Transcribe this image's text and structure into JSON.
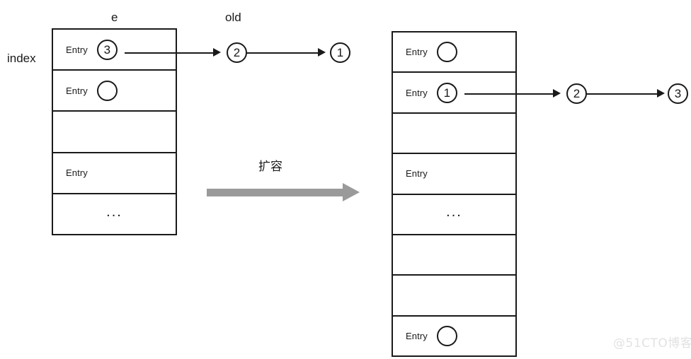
{
  "diagram": {
    "title_labels": {
      "index": "index",
      "e": "e",
      "old": "old"
    },
    "transform": {
      "label": "扩容",
      "arrow_color": "#9a9a9a"
    },
    "watermark": "@51CTO博客",
    "stroke_color": "#1a1a1a",
    "background_color": "#ffffff"
  },
  "left_table": {
    "name": "old-bucket-array",
    "rows": [
      {
        "label": "Entry",
        "node": "3",
        "dots": ""
      },
      {
        "label": "Entry",
        "node": "",
        "dots": ""
      },
      {
        "label": "",
        "node": null,
        "dots": ""
      },
      {
        "label": "Entry",
        "node": null,
        "dots": ""
      },
      {
        "label": "",
        "node": null,
        "dots": "..."
      }
    ]
  },
  "left_chain": {
    "nodes": [
      "3",
      "2",
      "1"
    ]
  },
  "right_table": {
    "name": "new-bucket-array",
    "rows": [
      {
        "label": "Entry",
        "node": "",
        "dots": ""
      },
      {
        "label": "Entry",
        "node": "1",
        "dots": ""
      },
      {
        "label": "",
        "node": null,
        "dots": ""
      },
      {
        "label": "Entry",
        "node": null,
        "dots": ""
      },
      {
        "label": "",
        "node": null,
        "dots": "..."
      },
      {
        "label": "",
        "node": null,
        "dots": ""
      },
      {
        "label": "",
        "node": null,
        "dots": ""
      },
      {
        "label": "Entry",
        "node": "",
        "dots": ""
      }
    ]
  },
  "right_chain": {
    "nodes": [
      "1",
      "2",
      "3"
    ]
  }
}
